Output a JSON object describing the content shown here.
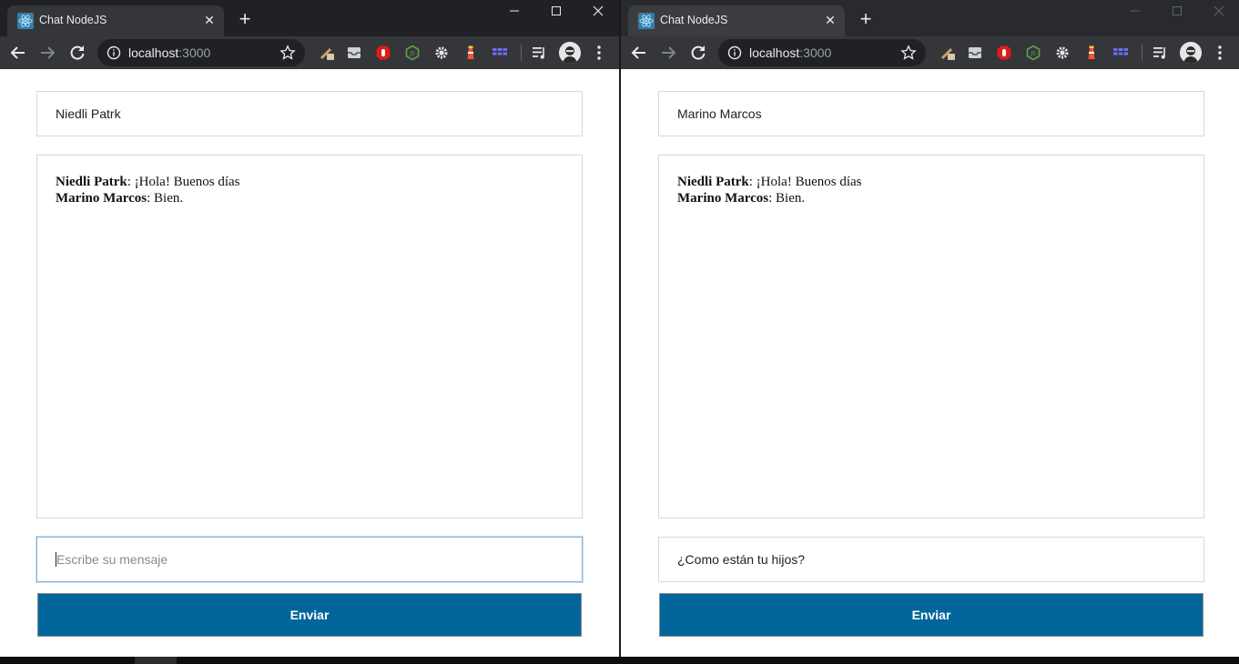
{
  "windows": [
    {
      "tab_title": "Chat NodeJS",
      "url_host": "localhost",
      "url_port": ":3000",
      "username": "Niedli Patrk",
      "messages": [
        {
          "author": "Niedli Patrk",
          "text": ": ¡Hola! Buenos días"
        },
        {
          "author": "Marino Marcos",
          "text": ": Bien."
        }
      ],
      "input_placeholder": "Escribe su mensaje",
      "input_value": "",
      "send_label": "Enviar"
    },
    {
      "tab_title": "Chat NodeJS",
      "url_host": "localhost",
      "url_port": ":3000",
      "username": "Marino Marcos",
      "messages": [
        {
          "author": "Niedli Patrk",
          "text": ": ¡Hola! Buenos días"
        },
        {
          "author": "Marino Marcos",
          "text": ": Bien."
        }
      ],
      "input_placeholder": "Escribe su mensaje",
      "input_value": "¿Como están tu hijos?",
      "send_label": "Enviar"
    }
  ],
  "colors": {
    "send_button": "#03669a",
    "titlebar": "#202124",
    "toolbar": "#35363a"
  },
  "icons": [
    "react-favicon-icon",
    "close-icon",
    "plus-icon",
    "minimize-icon",
    "maximize-icon",
    "back-icon",
    "forward-icon",
    "reload-icon",
    "info-icon",
    "star-icon",
    "menu-icon"
  ]
}
